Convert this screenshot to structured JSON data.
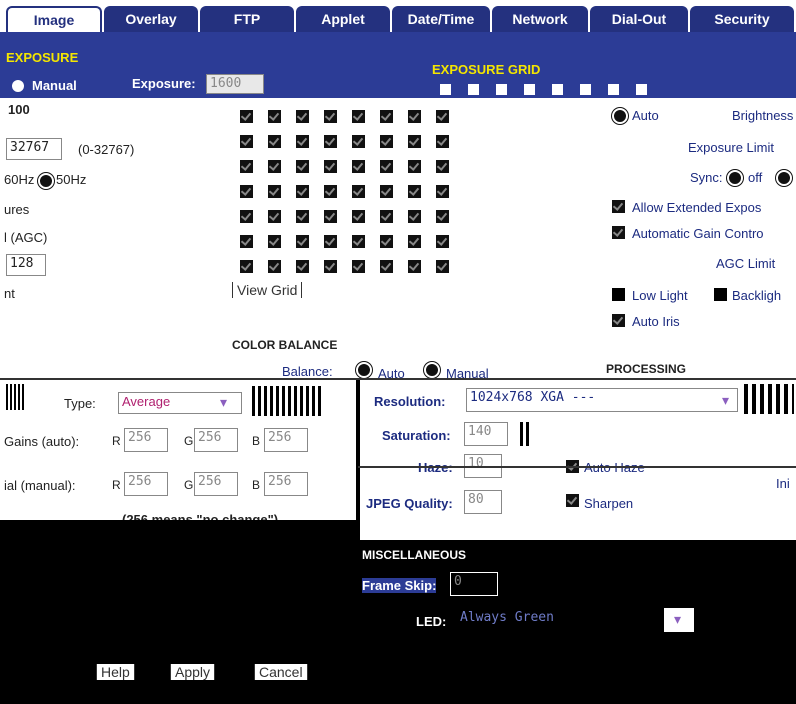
{
  "tabs": [
    {
      "label": "Image",
      "active": true
    },
    {
      "label": "Overlay"
    },
    {
      "label": "FTP"
    },
    {
      "label": "Applet"
    },
    {
      "label": "Date/Time"
    },
    {
      "label": "Network"
    },
    {
      "label": "Dial-Out"
    },
    {
      "label": "Security"
    }
  ],
  "exposure": {
    "section_title": "EXPOSURE",
    "manual_label": "Manual",
    "exposure_label": "Exposure:",
    "exposure_value": "1600",
    "grid_title": "EXPOSURE GRID",
    "value_100": "100",
    "value_32767": "32767",
    "range_label": "(0-32767)",
    "hz_60": "60Hz",
    "hz_50": "50Hz",
    "ures": "ures",
    "agc_label": "l (AGC)",
    "value_128": "128",
    "nt_label": "nt",
    "view_grid": "View Grid",
    "auto": "Auto",
    "brightness": "Brightness",
    "exposure_limit": "Exposure Limit",
    "sync_label": "Sync:",
    "sync_opt": "off",
    "allow_extended": "Allow Extended Expos",
    "agc_control": "Automatic Gain Contro",
    "agc_limit": "AGC Limit",
    "low_light": "Low Light",
    "backlight": "Backligh",
    "auto_iris": "Auto Iris"
  },
  "color": {
    "section_title": "COLOR BALANCE",
    "balance_label": "Balance:",
    "auto": "Auto",
    "manual": "Manual",
    "type_label": "Type:",
    "type_value": "Average",
    "gains_auto_label": "Gains (auto):",
    "gains_manual_label": "ial (manual):",
    "r": "R",
    "g": "G",
    "b": "B",
    "val": "256",
    "note": "(256 means \"no change\")"
  },
  "processing": {
    "section_title": "PROCESSING",
    "resolution_label": "Resolution:",
    "resolution_value": "1024x768 XGA ---",
    "saturation_label": "Saturation:",
    "saturation_value": "140",
    "haze_label": "Haze:",
    "haze_value": "10",
    "auto_haze": "Auto Haze",
    "jpeg_label": "JPEG Quality:",
    "jpeg_value": "80",
    "sharpen": "Sharpen",
    "ini": "Ini"
  },
  "misc": {
    "section_title": "MISCELLANEOUS",
    "frame_skip_label": "Frame Skip:",
    "frame_skip_value": "0",
    "led_label": "LED:",
    "led_value": "Always Green"
  },
  "footer": {
    "help": "Help",
    "apply": "Apply",
    "cancel": "Cancel"
  }
}
